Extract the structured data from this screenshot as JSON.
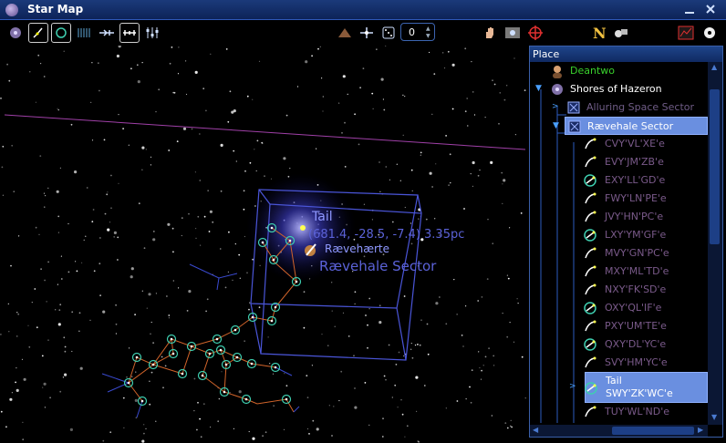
{
  "window": {
    "title": "Star Map"
  },
  "toolbar": {
    "zoom_step_value": "0"
  },
  "map": {
    "selected_star_label": "Tail",
    "selected_star_coords": "(681.4, -28.5, -7.4) 3.35pc",
    "ship_label": "Rævehærte",
    "sector_label": "Rævehale Sector"
  },
  "place_panel": {
    "header": "Place",
    "items": [
      {
        "label": "Deantwo",
        "color": "#39d12c",
        "icon": "avatar-icon"
      },
      {
        "label": "Shores of Hazeron",
        "color": "#ffffff",
        "icon": "galaxy-icon"
      },
      {
        "label": "Alluring Space Sector",
        "color": "#6f5c86",
        "icon": "sector-icon"
      },
      {
        "label": "Rævehale Sector",
        "color": "#ffffff",
        "icon": "sector-icon"
      },
      {
        "label": "CVY'VL'XE'e",
        "icon": "star-system-icon"
      },
      {
        "label": "EVY'JM'ZB'e",
        "icon": "star-system-icon"
      },
      {
        "label": "EXY'LL'GD'e",
        "icon": "inhabited-system-icon"
      },
      {
        "label": "FWY'LN'PE'e",
        "icon": "star-system-icon"
      },
      {
        "label": "JVY'HN'PC'e",
        "icon": "star-system-icon"
      },
      {
        "label": "LXY'YM'GF'e",
        "icon": "inhabited-system-icon"
      },
      {
        "label": "MVY'GN'PC'e",
        "icon": "star-system-icon"
      },
      {
        "label": "MXY'ML'TD'e",
        "icon": "star-system-icon"
      },
      {
        "label": "NXY'FK'SD'e",
        "icon": "star-system-icon"
      },
      {
        "label": "OXY'QL'IF'e",
        "icon": "inhabited-system-icon"
      },
      {
        "label": "PXY'UM'TE'e",
        "icon": "star-system-icon"
      },
      {
        "label": "QXY'DL'YC'e",
        "icon": "inhabited-system-icon"
      },
      {
        "label": "SVY'HM'YC'e",
        "icon": "star-system-icon"
      },
      {
        "label": "Tail",
        "sublabel": "SWY'ZK'WC'e",
        "icon": "inhabited-system-icon"
      },
      {
        "label": "TUY'WL'ND'e",
        "icon": "star-system-icon"
      }
    ]
  },
  "colors": {
    "titlebar": "#16307a",
    "accent": "#3a5fa8",
    "selection": "#6a8fe0",
    "route_line": "#d2642a",
    "system_marker": "#3ecfb0",
    "sector_box": "#4a55d8",
    "system_text": "#7a5a8a",
    "user_text": "#39d12c"
  }
}
